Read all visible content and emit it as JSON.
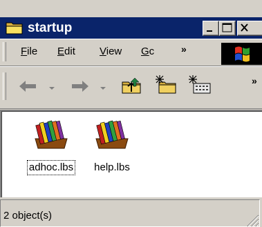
{
  "window": {
    "title": "startup"
  },
  "menu": {
    "items": [
      {
        "label": "File",
        "accel": "F"
      },
      {
        "label": "Edit",
        "accel": "E"
      },
      {
        "label": "View",
        "accel": "V"
      },
      {
        "label": "Go",
        "accel": "G"
      }
    ],
    "overflow_label": "»"
  },
  "toolbar": {
    "buttons": [
      "back-icon",
      "forward-icon",
      "up-folder-icon",
      "new-folder-icon",
      "properties-icon"
    ],
    "overflow_label": "»"
  },
  "files": [
    {
      "name": "adhoc.lbs",
      "icon": "library-books-icon",
      "focused": true
    },
    {
      "name": "help.lbs",
      "icon": "library-books-icon",
      "focused": false
    }
  ],
  "status": {
    "text": "2 object(s)"
  },
  "colors": {
    "title_bar": "#0a246a",
    "face": "#d4d0c8",
    "content_bg": "#ffffff"
  }
}
